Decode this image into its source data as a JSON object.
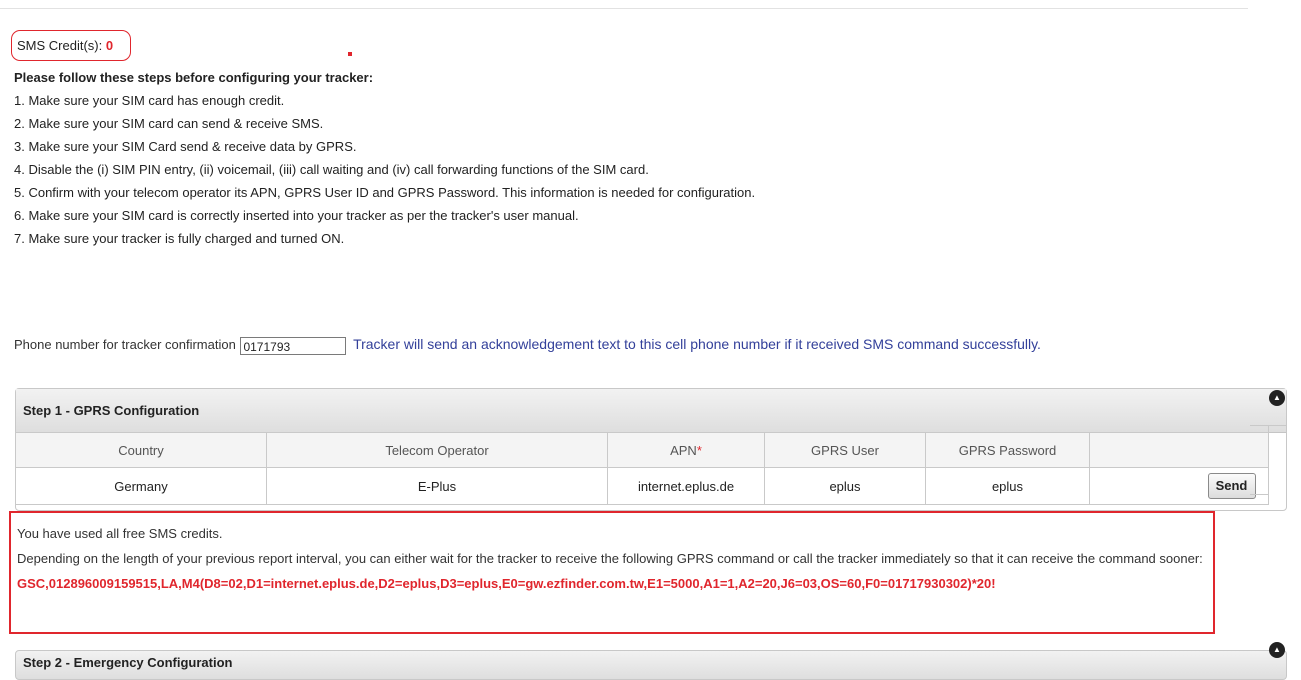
{
  "credit": {
    "label": "SMS Credit(s):",
    "value": "0"
  },
  "intro": {
    "heading": "Please follow these steps before configuring your tracker:",
    "steps": [
      "1. Make sure your SIM card has enough credit.",
      "2. Make sure your SIM card can send & receive SMS.",
      "3. Make sure your SIM Card send & receive data by GPRS.",
      "4. Disable the (i) SIM PIN entry, (ii) voicemail, (iii) call waiting and (iv) call forwarding functions of the SIM card.",
      "5. Confirm with your telecom operator its APN, GPRS User ID and GPRS Password. This information is needed for configuration.",
      "6. Make sure your SIM card is correctly inserted into your tracker as per the tracker's user manual.",
      "7. Make sure your tracker is fully charged and turned ON."
    ]
  },
  "phone": {
    "label": "Phone number for tracker confirmation",
    "value": "0171793",
    "note": "Tracker will send an acknowledgement text to this cell phone number if it received SMS command successfully."
  },
  "step1": {
    "title": "Step 1 - GPRS Configuration",
    "columns": {
      "country": "Country",
      "operator": "Telecom Operator",
      "apn": "APN",
      "apn_required": "*",
      "user": "GPRS User",
      "password": "GPRS Password"
    },
    "row": {
      "country": "Germany",
      "operator": "E-Plus",
      "apn": "internet.eplus.de",
      "user": "eplus",
      "password": "eplus"
    },
    "send_label": "Send",
    "collapse_icon": "collapse-up-icon"
  },
  "message": {
    "line1": "You have used all free SMS credits.",
    "line2": "Depending on the length of your previous report interval, you can either wait for the tracker to receive the following GPRS command or call the tracker immediately so that it can receive the command sooner:",
    "command": "GSC,012896009159515,LA,M4(D8=02,D1=internet.eplus.de,D2=eplus,D3=eplus,E0=gw.ezfinder.com.tw,E1=5000,A1=1,A2=20,J6=03,OS=60,F0=01717930302)*20!"
  },
  "step2": {
    "title": "Step 2 - Emergency Configuration"
  },
  "colors": {
    "accent_red": "#e0262d",
    "note_blue": "#33409a"
  }
}
